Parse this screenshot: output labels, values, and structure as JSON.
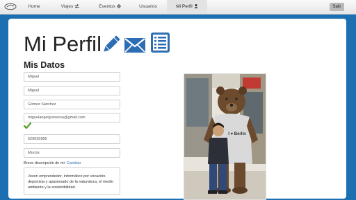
{
  "nav": {
    "items": [
      {
        "label": "Home"
      },
      {
        "label": "Viajes",
        "icon": "exchange-icon"
      },
      {
        "label": "Eventos",
        "icon": "crosshair-icon"
      },
      {
        "label": "Usuarios"
      },
      {
        "label": "Mi Perfil",
        "icon": "user-icon",
        "active": true
      }
    ],
    "logout_label": "Salir"
  },
  "profile": {
    "title": "Mi Perfil",
    "title_icons": [
      "pencil-icon",
      "envelope-icon",
      "list-icon"
    ],
    "section_title": "Mis Datos",
    "fields": {
      "first_name": "Miguel",
      "username": "Miguel",
      "last_name": "Gómez Sánchez",
      "email": "miguelangelgomezsa@gmail.com",
      "phone": "629035985",
      "city": "Murcia"
    },
    "email_verified_icon": "checkmark-icon",
    "description_label": "Breve descripción de mi:",
    "description_change_link": "Cambiar",
    "description_text": "Joven emprendedor, informático por vocación, deportista y apasionado de la naturaleza, el medio ambiente y la sostenibilidad.",
    "photo_sign_text": "I ♥ Berlin"
  },
  "colors": {
    "background": "#1c6fb0",
    "icon_blue": "#2d6db4",
    "check_green": "#5aa12a",
    "link": "#2a6fb8"
  }
}
